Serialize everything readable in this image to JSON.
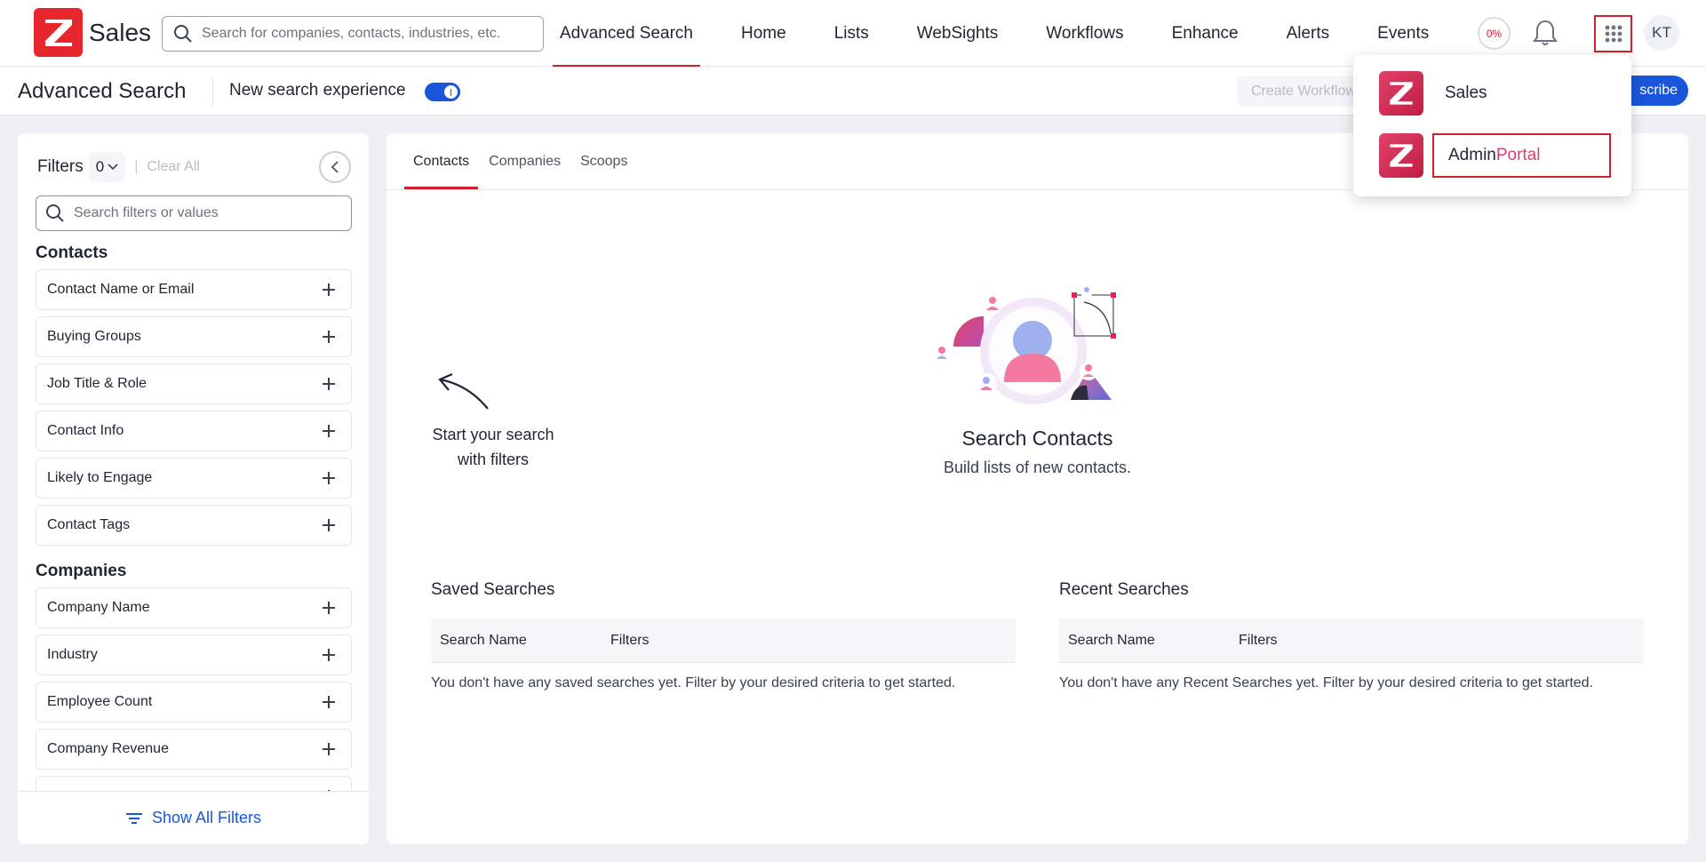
{
  "brand": {
    "name": "Sales",
    "accent": "#e8262e"
  },
  "topnav": {
    "search_placeholder": "Search for companies, contacts, industries, etc.",
    "items": [
      "Advanced Search",
      "Home",
      "Lists",
      "WebSights",
      "Workflows",
      "Enhance",
      "Alerts",
      "Events"
    ],
    "active_item": "Advanced Search",
    "credits": "0%",
    "avatar_initials": "KT"
  },
  "subheader": {
    "title": "Advanced Search",
    "experience_label": "New search experience",
    "experience_enabled": true,
    "create_workflow": "Create Workflow",
    "subscribe": "scribe"
  },
  "filters": {
    "label": "Filters",
    "count": "0",
    "clear_all": "Clear All",
    "search_placeholder": "Search filters or values",
    "contacts_title": "Contacts",
    "contacts": [
      "Contact Name or Email",
      "Buying Groups",
      "Job Title & Role",
      "Contact Info",
      "Likely to Engage",
      "Contact Tags"
    ],
    "companies_title": "Companies",
    "companies": [
      "Company Name",
      "Industry",
      "Employee Count",
      "Company Revenue"
    ],
    "show_all": "Show All Filters"
  },
  "main": {
    "tabs": [
      "Contacts",
      "Companies",
      "Scoops"
    ],
    "active_tab": "Contacts",
    "hint": "Start your search with filters",
    "empty_title": "Search Contacts",
    "empty_subtitle": "Build lists of new contacts.",
    "saved": {
      "title": "Saved Searches",
      "col_name": "Search Name",
      "col_filters": "Filters",
      "empty": "You don't have any saved searches yet. Filter by your desired criteria to get started."
    },
    "recent": {
      "title": "Recent Searches",
      "col_name": "Search Name",
      "col_filters": "Filters",
      "empty": "You don't have any Recent Searches yet. Filter by your desired criteria to get started."
    }
  },
  "app_menu": {
    "items": [
      {
        "label": "Sales"
      },
      {
        "label_a": "Admin",
        "label_b": "Portal"
      }
    ]
  }
}
